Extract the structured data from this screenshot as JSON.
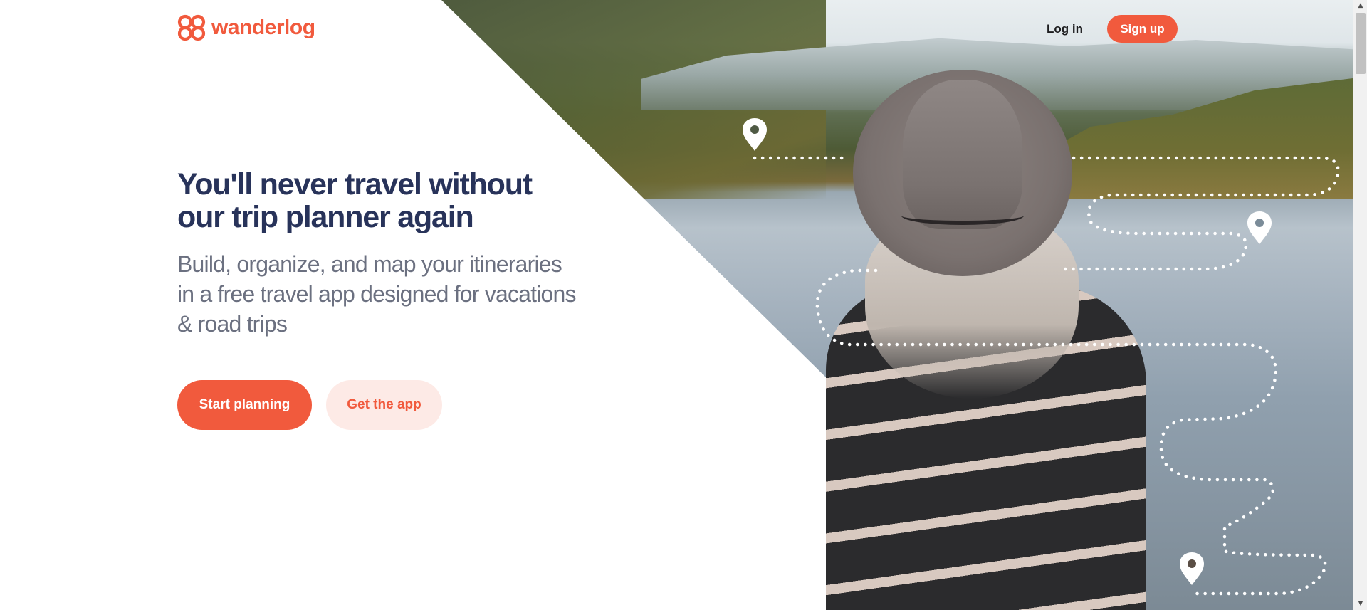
{
  "brand": {
    "name": "wanderlog",
    "color": "#f15a3d",
    "logo_icon": "wanderlog-logo-icon"
  },
  "header": {
    "login_label": "Log in",
    "signup_label": "Sign up"
  },
  "hero": {
    "title_line1": "You'll never travel without",
    "title_line2": "our trip planner again",
    "subtitle_line1": "Build, organize, and map your itineraries",
    "subtitle_line2": "in a free travel app designed for vacations",
    "subtitle_line3": "& road trips",
    "primary_cta": "Start planning",
    "secondary_cta": "Get the app"
  },
  "image": {
    "description_icon": "traveler-lake-photo",
    "map_pin_icon": "map-pin-icon"
  },
  "colors": {
    "title": "#28335a",
    "subtitle": "#6b7080",
    "cta_primary_bg": "#f15a3d",
    "cta_secondary_bg": "#fdeae6"
  }
}
